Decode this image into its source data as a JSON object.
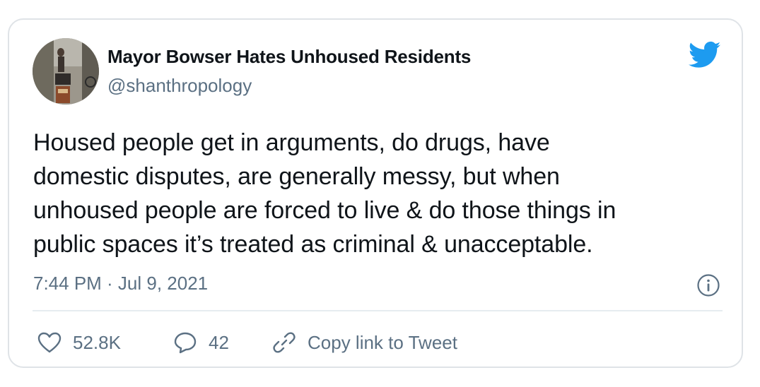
{
  "tweet": {
    "display_name": "Mayor Bowser Hates Unhoused Residents",
    "handle": "@shanthropology",
    "text_lines": [
      "Housed people get in arguments, do drugs, have",
      "domestic disputes, are generally messy, but when",
      "unhoused people are forced to live & do those things in",
      "public spaces it’s treated as criminal & unacceptable."
    ],
    "timestamp": "7:44 PM · Jul 9, 2021",
    "likes": "52.8K",
    "replies": "42",
    "copy_link_label": "Copy link to Tweet"
  },
  "icons": {
    "brand": "twitter-bird-icon",
    "info": "info-icon",
    "like": "heart-icon",
    "reply": "reply-bubble-icon",
    "copy": "link-icon"
  },
  "colors": {
    "brand_blue": "#1d9bf0",
    "text_primary": "#0f1419",
    "text_secondary": "#5b7083",
    "border": "#dfe3e7"
  }
}
